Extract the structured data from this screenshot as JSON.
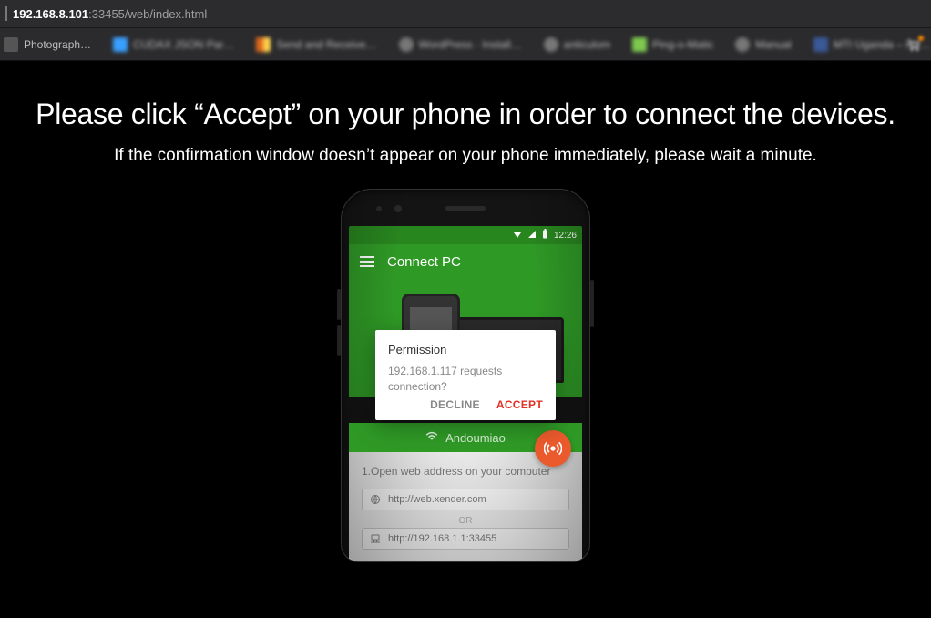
{
  "browser": {
    "url_host": "192.168.8.101",
    "url_rest": ":33455/web/index.html"
  },
  "bookmarks": [
    {
      "label": "Photograph…"
    },
    {
      "label": "CUDAX JSON Par…"
    },
    {
      "label": "Send and Receive…"
    },
    {
      "label": "WordPress · Install…"
    },
    {
      "label": "anticulom"
    },
    {
      "label": "Ping-o-Matic"
    },
    {
      "label": "Manual"
    },
    {
      "label": "MTI Uganda – He…"
    }
  ],
  "page": {
    "title": "Please click “Accept” on your phone in order to connect the devices.",
    "subtitle": "If the confirmation window doesn’t appear on your phone immediately, please wait a minute."
  },
  "phone": {
    "status_time": "12:26",
    "appbar_title": "Connect PC",
    "dialog": {
      "title": "Permission",
      "message": "192.168.1.117 requests connection?",
      "decline": "DECLINE",
      "accept": "ACCEPT"
    },
    "wifi_name": "Andoumiao",
    "step_text": "1.Open web address on your computer",
    "address_web": "http://web.xender.com",
    "or_label": "OR",
    "address_lan": "http://192.168.1.1:33455"
  }
}
